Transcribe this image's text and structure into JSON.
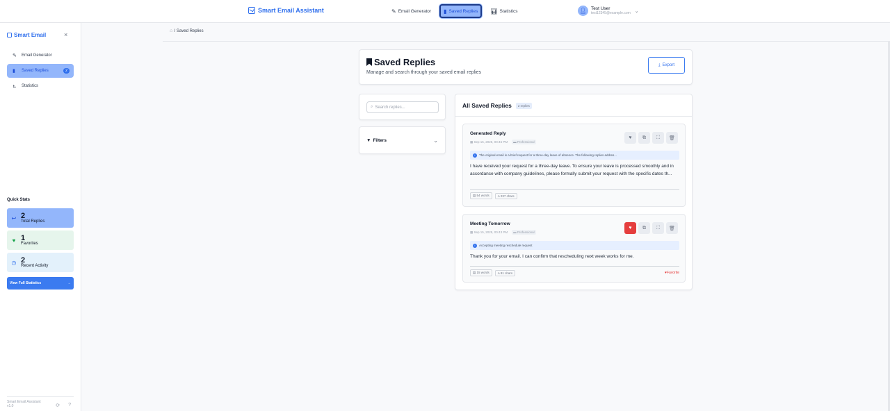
{
  "app": {
    "brand": "Smart Email Assistant"
  },
  "nav": {
    "links": [
      {
        "label": "Email Generator",
        "icon": "pencil-icon"
      },
      {
        "label": "Saved Replies",
        "icon": "bookmark-icon"
      },
      {
        "label": "Statistics",
        "icon": "chart-icon"
      }
    ],
    "active_link": "Saved Replies"
  },
  "user": {
    "name": "Test User",
    "email": "test12345@example.com"
  },
  "sidebar": {
    "title": "Smart Email",
    "items": [
      {
        "label": "Email Generator"
      },
      {
        "label": "Saved Replies",
        "badge": "2"
      },
      {
        "label": "Statistics"
      }
    ],
    "quick_stats_title": "Quick Stats",
    "stats": [
      {
        "value": "2",
        "label": "Total Replies"
      },
      {
        "value": "1",
        "label": "Favorites"
      },
      {
        "value": "2",
        "label": "Recent Activity"
      }
    ],
    "view_all": "View Full Statistics",
    "footer_name": "Smart Email Assistant",
    "footer_version": "v1.0"
  },
  "breadcrumb": {
    "current": "Saved Replies"
  },
  "page": {
    "title": "Saved Replies",
    "subtitle": "Manage and search through your saved email replies",
    "export_label": "Export"
  },
  "search": {
    "placeholder": "Search replies..."
  },
  "filters": {
    "label": "Filters"
  },
  "list": {
    "title": "All Saved Replies",
    "count": "2 replies",
    "replies": [
      {
        "title": "Generated Reply",
        "date": "Sep 15, 2025, 00:46 PM",
        "tone": "Professional",
        "note": "The original email is a brief request for a three-day leave of absence. The following replies addres...",
        "body": "I have received your request for a three-day leave. To ensure your leave is processed smoothly and in accordance with company guidelines, please formally submit your request with the specific dates th...",
        "words": "54 words",
        "chars": "237 chars",
        "favorite": false
      },
      {
        "title": "Meeting Tomorrow",
        "date": "Sep 15, 2025, 00:43 PM",
        "tone": "Professional",
        "note": "Accepting meeting reschedule request",
        "body": "Thank you for your email. I can confirm that rescheduling next week works for me.",
        "words": "15 words",
        "chars": "81 chars",
        "favorite": true,
        "favorite_label": "Favorite"
      }
    ]
  },
  "colors": {
    "accent": "#2f6fed",
    "favorite": "#e53e3e"
  }
}
